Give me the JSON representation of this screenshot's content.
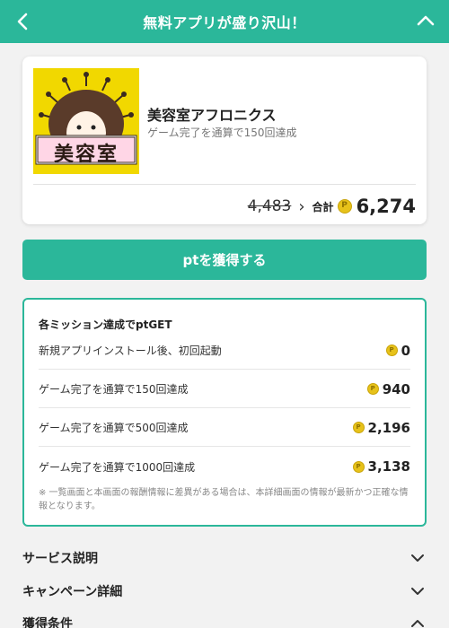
{
  "header": {
    "title": "無料アプリが盛り沢山！",
    "back_icon": "chevron-left-icon",
    "collapse_icon": "chevron-up-icon"
  },
  "app": {
    "thumbnail_text": "美容室",
    "name": "美容室アフロニクス",
    "subtitle": "ゲーム完了を通算で150回達成",
    "old_points": "4,483",
    "total_label": "合計",
    "total_points": "6,274"
  },
  "cta": {
    "label": "ptを獲得する"
  },
  "missions": {
    "title": "各ミッション達成でptGET",
    "items": [
      {
        "label": "新規アプリインストール後、初回起動",
        "points": "0"
      },
      {
        "label": "ゲーム完了を通算で150回達成",
        "points": "940"
      },
      {
        "label": "ゲーム完了を通算で500回達成",
        "points": "2,196"
      },
      {
        "label": "ゲーム完了を通算で1000回達成",
        "points": "3,138"
      }
    ],
    "note": "※ 一覧画面と本画面の報酬情報に差異がある場合は、本詳細画面の情報が最新かつ正確な情報となります。"
  },
  "accordions": [
    {
      "label": "サービス説明",
      "icon": "chevron-down-icon"
    },
    {
      "label": "キャンペーン詳細",
      "icon": "chevron-down-icon"
    },
    {
      "label": "獲得条件",
      "icon": "chevron-up-icon"
    }
  ],
  "colors": {
    "accent": "#2bb79a",
    "coin": "#e7c21a",
    "thumbnail_bg": "#f1d800"
  }
}
